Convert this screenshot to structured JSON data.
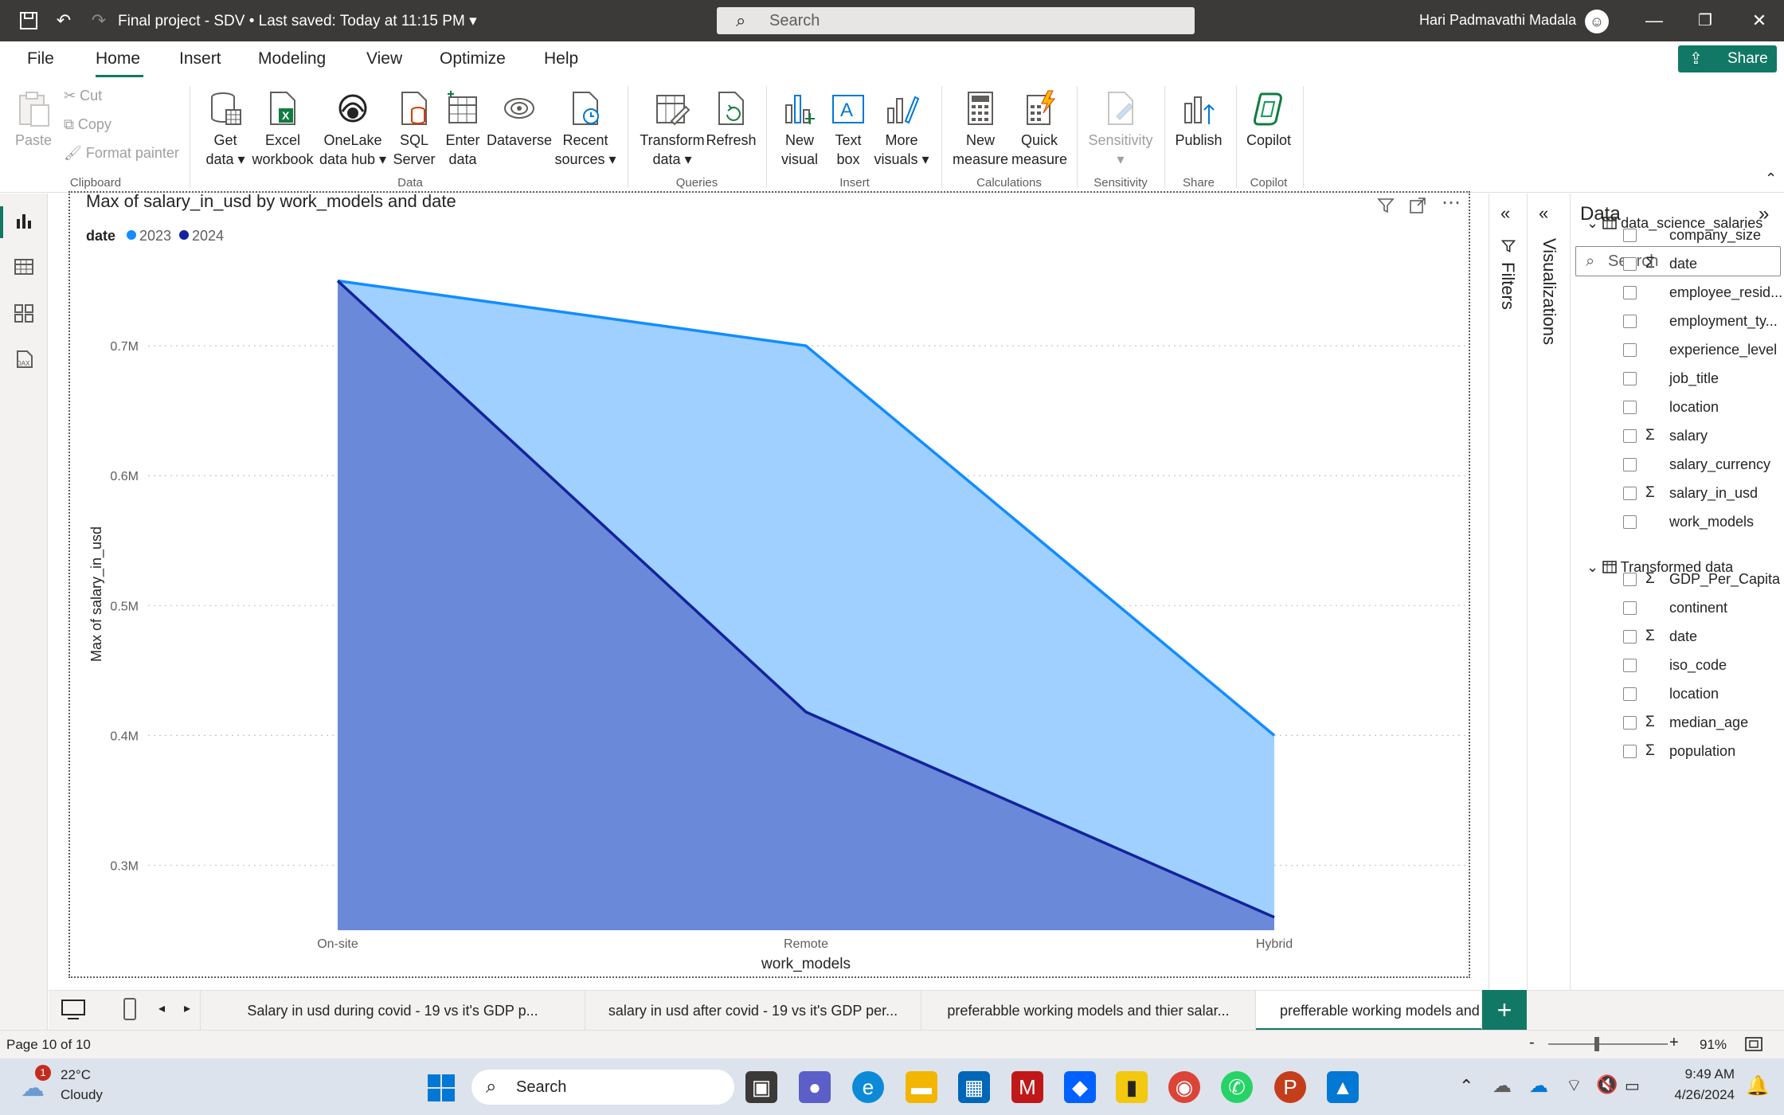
{
  "titlebar": {
    "doc_title": "Final project - SDV • Last saved: Today at 11:15 PM",
    "search_placeholder": "Search",
    "user_name": "Hari Padmavathi Madala"
  },
  "menu": {
    "tabs": [
      "File",
      "Home",
      "Insert",
      "Modeling",
      "View",
      "Optimize",
      "Help"
    ],
    "active": "Home",
    "share_label": "Share"
  },
  "ribbon": {
    "clipboard": {
      "paste": "Paste",
      "cut": "Cut",
      "copy": "Copy",
      "format_painter": "Format painter",
      "group": "Clipboard"
    },
    "data": {
      "get_data": [
        "Get",
        "data"
      ],
      "excel": [
        "Excel",
        "workbook"
      ],
      "onelake": [
        "OneLake",
        "data hub"
      ],
      "sql": [
        "SQL",
        "Server"
      ],
      "enter": [
        "Enter",
        "data"
      ],
      "dataverse": [
        "Dataverse",
        ""
      ],
      "recent": [
        "Recent",
        "sources"
      ],
      "group": "Data"
    },
    "queries": {
      "transform": [
        "Transform",
        "data"
      ],
      "refresh": [
        "Refresh",
        ""
      ],
      "group": "Queries"
    },
    "insert": {
      "new_visual": [
        "New",
        "visual"
      ],
      "text_box": [
        "Text",
        "box"
      ],
      "more_visuals": [
        "More",
        "visuals"
      ],
      "group": "Insert"
    },
    "calculations": {
      "new_measure": [
        "New",
        "measure"
      ],
      "quick_measure": [
        "Quick",
        "measure"
      ],
      "group": "Calculations"
    },
    "sensitivity": {
      "label": "Sensitivity",
      "group": "Sensitivity"
    },
    "share": {
      "publish": "Publish",
      "group": "Share"
    },
    "copilot": {
      "label": "Copilot",
      "group": "Copilot"
    }
  },
  "panes": {
    "filters": "Filters",
    "visualizations": "Visualizations",
    "data_title": "Data",
    "data_search": "Search"
  },
  "tables": [
    {
      "name": "data_science_salaries",
      "fields": [
        {
          "name": "company_size",
          "sigma": false
        },
        {
          "name": "date",
          "sigma": true
        },
        {
          "name": "employee_resid...",
          "sigma": false
        },
        {
          "name": "employment_ty...",
          "sigma": false
        },
        {
          "name": "experience_level",
          "sigma": false
        },
        {
          "name": "job_title",
          "sigma": false
        },
        {
          "name": "location",
          "sigma": false
        },
        {
          "name": "salary",
          "sigma": true
        },
        {
          "name": "salary_currency",
          "sigma": false
        },
        {
          "name": "salary_in_usd",
          "sigma": true
        },
        {
          "name": "work_models",
          "sigma": false
        }
      ]
    },
    {
      "name": "Transformed data",
      "fields": [
        {
          "name": "GDP_Per_Capita",
          "sigma": true
        },
        {
          "name": "continent",
          "sigma": false
        },
        {
          "name": "date",
          "sigma": true
        },
        {
          "name": "iso_code",
          "sigma": false
        },
        {
          "name": "location",
          "sigma": false
        },
        {
          "name": "median_age",
          "sigma": true
        },
        {
          "name": "population",
          "sigma": true
        }
      ]
    }
  ],
  "chart_data": {
    "type": "area",
    "title": "Max of salary_in_usd by work_models and date",
    "legend_title": "date",
    "legend_position": "top-left",
    "categories": [
      "On-site",
      "Remote",
      "Hybrid"
    ],
    "series": [
      {
        "name": "2023",
        "color": "#118DFF",
        "fill": "#9FD0FF",
        "values": [
          750000,
          700000,
          400000
        ]
      },
      {
        "name": "2024",
        "color": "#12239E",
        "fill": "#6A8AD9",
        "values": [
          750000,
          418000,
          260000
        ]
      }
    ],
    "xlabel": "work_models",
    "ylabel": "Max of salary_in_usd",
    "yticks": [
      300000,
      400000,
      500000,
      600000,
      700000
    ],
    "ytick_labels": [
      "0.3M",
      "0.4M",
      "0.5M",
      "0.6M",
      "0.7M"
    ],
    "ylim": [
      250000,
      770000
    ],
    "grid": true
  },
  "pages": [
    "Salary in usd during covid - 19 vs it's GDP p...",
    "salary in usd after covid - 19 vs it's GDP per...",
    "preferabble working models and thier salar...",
    "prefferable working models and thier s"
  ],
  "status": {
    "page": "Page 10 of 10",
    "zoom": "91%"
  },
  "taskbar": {
    "temp": "22°C",
    "weather": "Cloudy",
    "weather_badge": "1",
    "search": "Search",
    "time": "9:49 AM",
    "date": "4/26/2024"
  }
}
